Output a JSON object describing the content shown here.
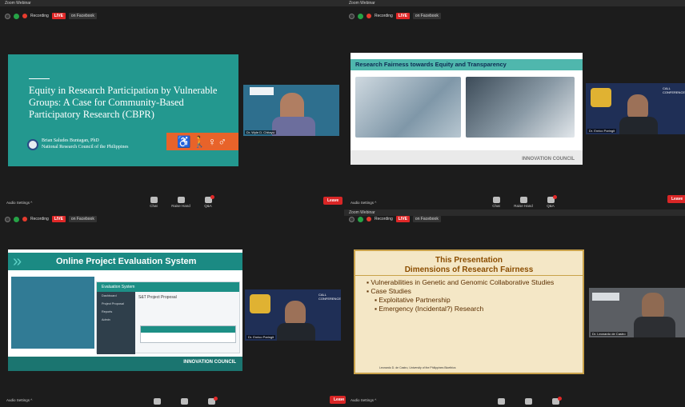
{
  "app": {
    "title": "Zoom Webinar"
  },
  "status": {
    "recording": "Recording",
    "live": "LIVE",
    "platform": "on Facebook"
  },
  "controls": {
    "audio": "Audio Settings ^",
    "chat": "Chat",
    "raise_hand": "Raise Hand",
    "qa": "Q&A",
    "leave": "Leave"
  },
  "w1": {
    "slide": {
      "title": "Equity in Research Participation by Vulnerable Groups: A Case for Community-Based Participatory Research (CBPR)",
      "author": "Brian Saludes Buntagan, PhD",
      "org": "National Research Council of the Philippines",
      "figures": "♿🚶♀♂"
    },
    "video": {
      "name": "Dr. Wyle D. Chitayu"
    }
  },
  "w2": {
    "slide": {
      "title": "Research Fairness towards Equity and Transparency",
      "footer": "INNOVATION COUNCIL"
    },
    "video": {
      "name": "Dr. Enrico Paringit",
      "banner": "CALL CONFERENCE"
    }
  },
  "w3": {
    "slide": {
      "title": "Online Project Evaluation System",
      "app_title": "Evaluation System",
      "page_title": "S&T Project Proposal",
      "menu": [
        "Dashboard",
        "Project Proposal",
        "Reports",
        "Admin"
      ],
      "footer": "INNOVATION COUNCIL"
    },
    "video": {
      "name": "Dr. Enrico Paringit",
      "banner": "CALL CONFERENCE"
    }
  },
  "w4": {
    "slide": {
      "title1": "This Presentation",
      "title2": "Dimensions of Research Fairness",
      "bullets": [
        {
          "text": "Vulnerabilities in Genetic and Genomic Collaborative Studies",
          "sub": false
        },
        {
          "text": "Case Studies",
          "sub": false
        },
        {
          "text": "Exploitative Partnership",
          "sub": true
        },
        {
          "text": "Emergency (Incidental?) Research",
          "sub": true
        }
      ],
      "credit": "Leonardo D. de Castro, University of the Philippines Bioethics"
    },
    "video": {
      "name": "Dr. Leonardo de Castro"
    }
  },
  "colors": {
    "live": "#e02828",
    "leave": "#d92626",
    "teal": "#23988f"
  }
}
